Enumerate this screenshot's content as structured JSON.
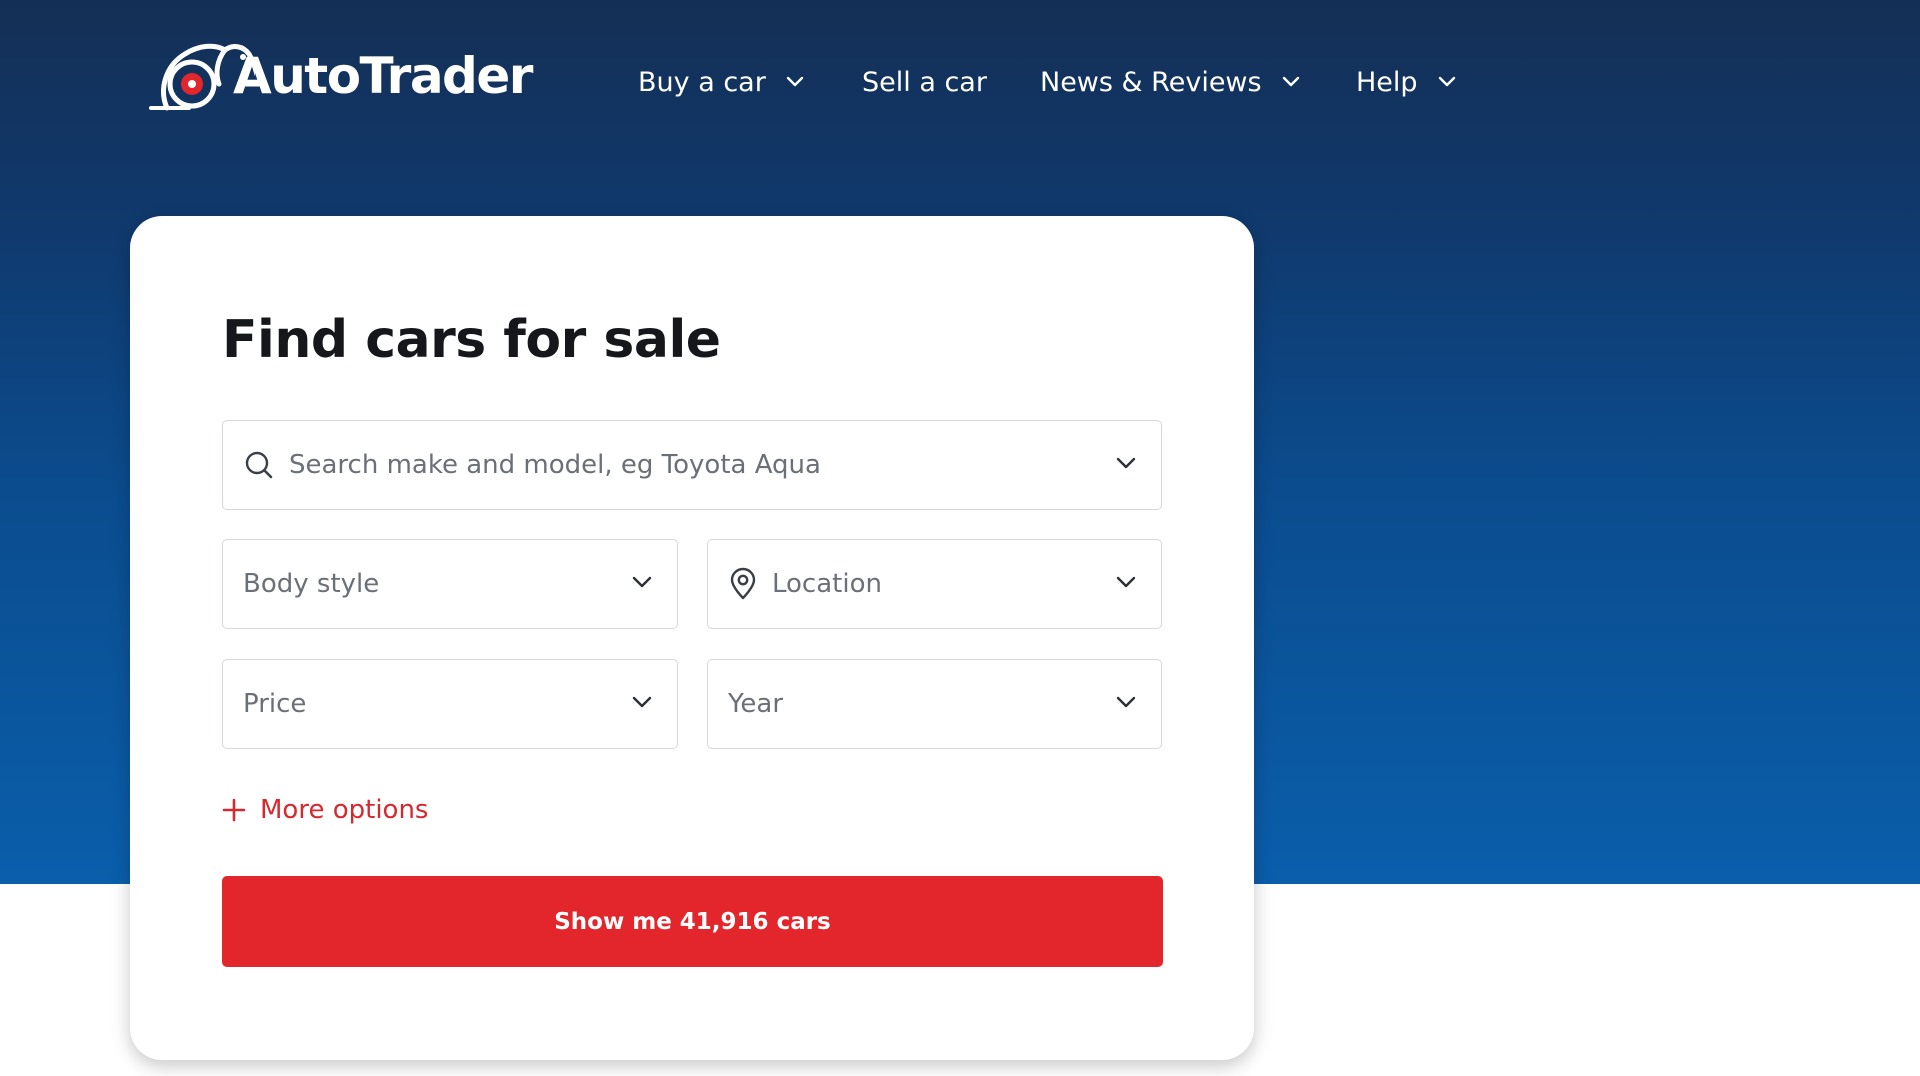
{
  "header": {
    "logo": {
      "text": "AutoTrader"
    },
    "nav": [
      {
        "label": "Buy a car",
        "has_dropdown": true
      },
      {
        "label": "Sell a car",
        "has_dropdown": false
      },
      {
        "label": "News & Reviews",
        "has_dropdown": true
      },
      {
        "label": "Help",
        "has_dropdown": true
      }
    ]
  },
  "search_card": {
    "title": "Find cars for sale",
    "make_model": {
      "placeholder": "Search make and model, eg Toyota Aqua",
      "icon": "search-icon"
    },
    "body_style": {
      "placeholder": "Body style"
    },
    "location": {
      "placeholder": "Location",
      "icon": "map-pin-icon"
    },
    "price": {
      "placeholder": "Price"
    },
    "year": {
      "placeholder": "Year"
    },
    "more_options": {
      "label": "More options",
      "icon": "plus-icon"
    },
    "submit": {
      "label": "Show me 41,916 cars"
    }
  },
  "colors": {
    "hero_top": "#142f55",
    "hero_bottom": "#0a5eab",
    "brand_red": "#e3262b",
    "link_red": "#d42a2f",
    "title_text": "#15171a",
    "placeholder_text": "#6b7078",
    "field_border": "#d4d7dc"
  }
}
